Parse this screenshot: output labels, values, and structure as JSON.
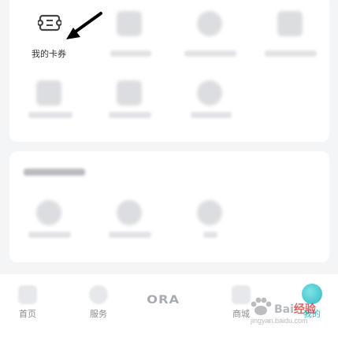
{
  "my_section": {
    "items": [
      {
        "label": "我的卡券",
        "icon": "ticket-icon"
      },
      {
        "label": "",
        "icon": "flag-icon"
      },
      {
        "label": "",
        "icon": "gear-icon"
      },
      {
        "label": "",
        "icon": "doc-icon"
      },
      {
        "label": "",
        "icon": "box-icon"
      },
      {
        "label": "",
        "icon": "person-icon"
      },
      {
        "label": "",
        "icon": "gear-icon"
      }
    ]
  },
  "services_section": {
    "title": "",
    "items": [
      {
        "label": "",
        "icon": "gear-icon"
      },
      {
        "label": "",
        "icon": "gear-icon"
      },
      {
        "label": "",
        "icon": "gear-icon"
      }
    ]
  },
  "bottom_nav": {
    "items": [
      {
        "label": "首页",
        "icon": "home-icon"
      },
      {
        "label": "服务",
        "icon": "heart-icon"
      },
      {
        "label": "ORA",
        "icon": "ora-logo"
      },
      {
        "label": "商城",
        "icon": "shop-icon"
      },
      {
        "label": "我的",
        "icon": "user-avatar-icon"
      }
    ]
  },
  "watermark": {
    "brand": "Bai",
    "brand2": "经验",
    "url": "jingyan.baidu.com"
  },
  "colors": {
    "accent": "#2fb9c9",
    "card_bg": "#ffffff",
    "page_bg": "#f4f5f7"
  }
}
